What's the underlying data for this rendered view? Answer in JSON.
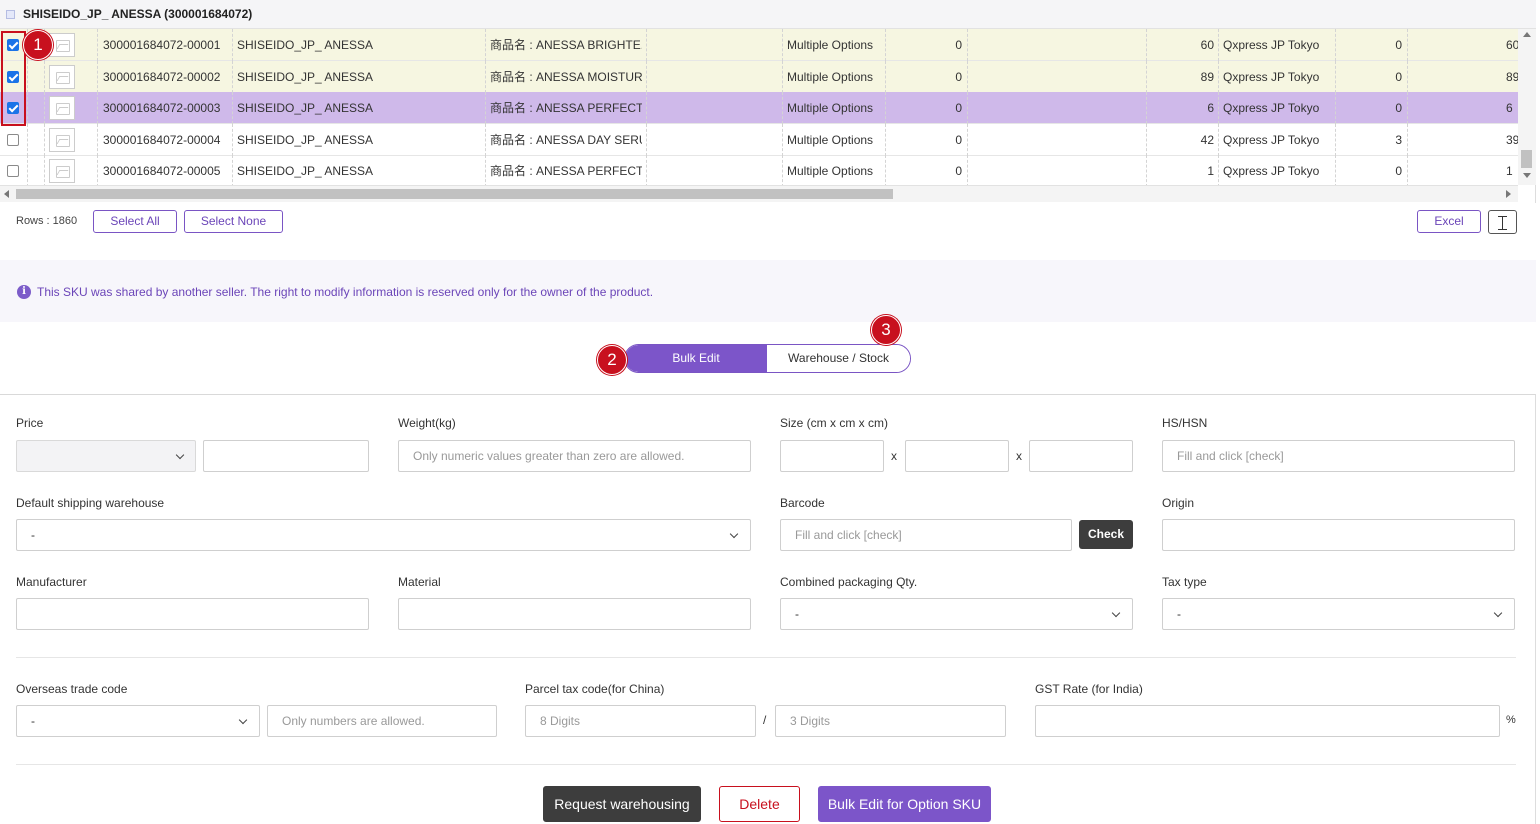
{
  "grid": {
    "group_title": "SHISEIDO_JP_ ANESSA (300001684072)",
    "rows": [
      {
        "checked": true,
        "state": "sel",
        "sku": "300001684072-00001",
        "brand": "SHISEIDO_JP_ ANESSA",
        "name": "商品名 : ANESSA BRIGHTE...",
        "option": "Multiple Options",
        "n1": "0",
        "n2": "60",
        "warehouse": "Qxpress JP Tokyo",
        "n3": "0",
        "n4": "60"
      },
      {
        "checked": true,
        "state": "sel",
        "sku": "300001684072-00002",
        "brand": "SHISEIDO_JP_ ANESSA",
        "name": "商品名 : ANESSA MOISTUR...",
        "option": "Multiple Options",
        "n1": "0",
        "n2": "89",
        "warehouse": "Qxpress JP Tokyo",
        "n3": "0",
        "n4": "89"
      },
      {
        "checked": true,
        "state": "active",
        "sku": "300001684072-00003",
        "brand": "SHISEIDO_JP_ ANESSA",
        "name": "商品名 : ANESSA PERFECT ...",
        "option": "Multiple Options",
        "n1": "0",
        "n2": "6",
        "warehouse": "Qxpress JP Tokyo",
        "n3": "0",
        "n4": "6"
      },
      {
        "checked": false,
        "state": "",
        "sku": "300001684072-00004",
        "brand": "SHISEIDO_JP_ ANESSA",
        "name": "商品名 : ANESSA DAY SERU...",
        "option": "Multiple Options",
        "n1": "0",
        "n2": "42",
        "warehouse": "Qxpress JP Tokyo",
        "n3": "3",
        "n4": "39"
      },
      {
        "checked": false,
        "state": "",
        "sku": "300001684072-00005",
        "brand": "SHISEIDO_JP_ ANESSA",
        "name": "商品名 : ANESSA PERFECT ...",
        "option": "Multiple Options",
        "n1": "0",
        "n2": "1",
        "warehouse": "Qxpress JP Tokyo",
        "n3": "0",
        "n4": "1"
      }
    ],
    "rows_count": "Rows : 1860",
    "select_all": "Select All",
    "select_none": "Select None",
    "excel": "Excel"
  },
  "notice": {
    "icon": "i",
    "text": "This SKU was shared by another seller. The right to modify information is reserved only for the owner of the product."
  },
  "tabs": {
    "bulk_edit": "Bulk Edit",
    "warehouse_stock": "Warehouse / Stock"
  },
  "markers": {
    "m1": "1",
    "m2": "2",
    "m3": "3"
  },
  "form": {
    "price_label": "Price",
    "weight_label": "Weight(kg)",
    "weight_placeholder": "Only numeric values greater than zero are allowed.",
    "size_label": "Size (cm x cm x cm)",
    "size_sep": "x",
    "hs_label": "HS/HSN",
    "hs_placeholder": "Fill and click [check]",
    "default_wh_label": "Default shipping warehouse",
    "default_wh_value": "-",
    "barcode_label": "Barcode",
    "barcode_placeholder": "Fill and click [check]",
    "check_btn": "Check",
    "origin_label": "Origin",
    "manufacturer_label": "Manufacturer",
    "material_label": "Material",
    "combined_label": "Combined packaging Qty.",
    "combined_value": "-",
    "tax_label": "Tax type",
    "tax_value": "-",
    "overseas_label": "Overseas trade code",
    "overseas_value": "-",
    "overseas_placeholder": "Only numbers are allowed.",
    "parcel_label": "Parcel tax code(for China)",
    "parcel_p1": "8 Digits",
    "parcel_sep": "/",
    "parcel_p2": "3 Digits",
    "gst_label": "GST Rate (for India)",
    "gst_unit": "%"
  },
  "actions": {
    "request": "Request warehousing",
    "delete": "Delete",
    "bulk_option": "Bulk Edit for Option SKU"
  }
}
